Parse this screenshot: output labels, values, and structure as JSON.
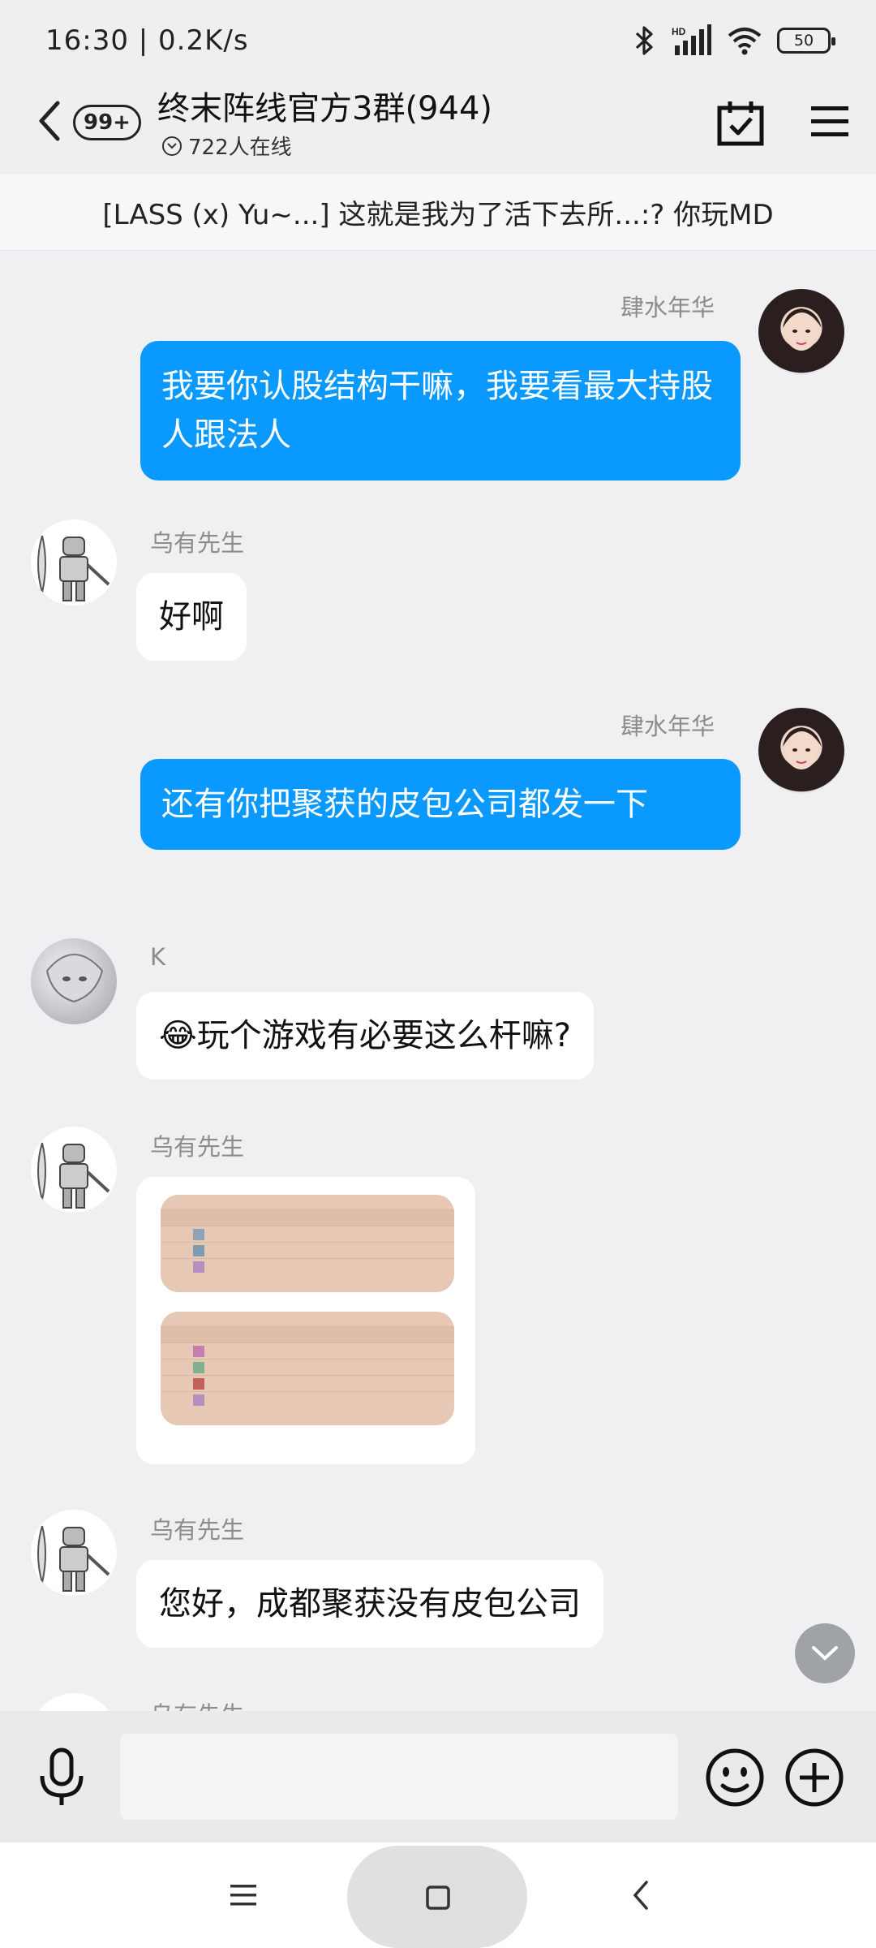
{
  "status_bar": {
    "time_speed": "16:30 | 0.2K/s",
    "hd_label": "HD",
    "battery": "50"
  },
  "header": {
    "badge": "99+",
    "title": "终末阵线官方3群(944)",
    "online": "722人在线"
  },
  "notice": {
    "text": "[LASS (x) Yu~...] 这就是我为了活下去所...:? 你玩MD"
  },
  "messages": [
    {
      "sender": "肆水年华",
      "text": "我要你认股结构干嘛，我要看最大持股人跟法人",
      "outgoing": true
    },
    {
      "sender": "乌有先生",
      "text": "好啊",
      "outgoing": false
    },
    {
      "sender": "肆水年华",
      "text": "还有你把聚获的皮包公司都发一下",
      "outgoing": true
    },
    {
      "sender": "K",
      "text": "😂玩个游戏有必要这么杆嘛?",
      "outgoing": false
    },
    {
      "sender": "乌有先生",
      "image": "screenshot-tables",
      "outgoing": false
    },
    {
      "sender": "乌有先生",
      "text": "您好，成都聚获没有皮包公司",
      "outgoing": false
    },
    {
      "sender": "乌有先生",
      "outgoing": false
    }
  ],
  "input": {
    "placeholder": ""
  },
  "colors": {
    "outgoing_bubble": "#0a99ff",
    "incoming_bubble": "#ffffff",
    "background": "#f0f0f2"
  }
}
